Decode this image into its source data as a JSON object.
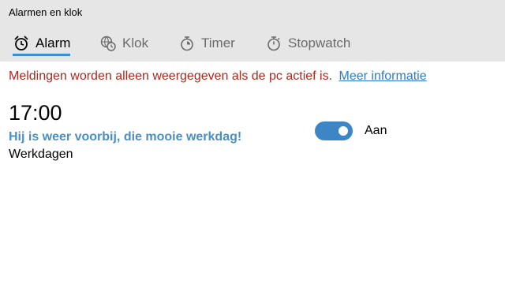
{
  "window": {
    "title": "Alarmen en klok"
  },
  "tabs": [
    {
      "label": "Alarm",
      "icon": "alarm-clock-icon",
      "active": true
    },
    {
      "label": "Klok",
      "icon": "world-clock-icon",
      "active": false
    },
    {
      "label": "Timer",
      "icon": "timer-icon",
      "active": false
    },
    {
      "label": "Stopwatch",
      "icon": "stopwatch-icon",
      "active": false
    }
  ],
  "notice": {
    "message": "Meldingen worden alleen weergegeven als de pc actief is.",
    "link": "Meer informatie"
  },
  "alarm": {
    "time": "17:00",
    "name": "Hij is weer voorbij, die mooie werkdag!",
    "repeat": "Werkdagen",
    "toggle_label": "Aan",
    "enabled": true
  },
  "colors": {
    "accent": "#3b8fd6",
    "warning": "#b0281e",
    "link": "#2b7fc3",
    "alarm_name": "#4a8fc4",
    "chrome": "#e6e6e6"
  }
}
